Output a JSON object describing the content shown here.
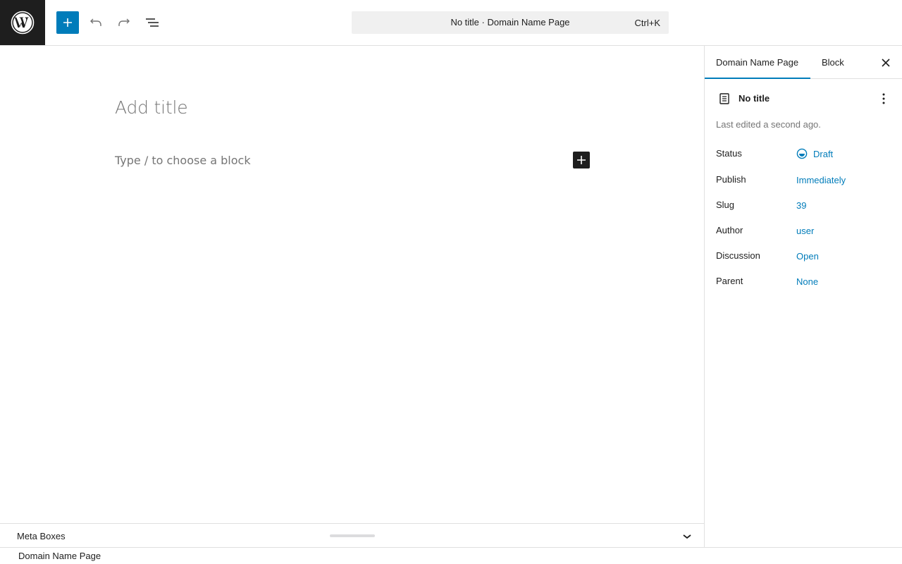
{
  "header": {
    "logo_icon": "wordpress-logo-icon",
    "inserter_icon": "plus-icon",
    "undo_icon": "undo-icon",
    "redo_icon": "redo-icon",
    "list_view_icon": "list-view-icon",
    "command_bar": {
      "title": "No title · Domain Name Page",
      "shortcut": "Ctrl+K"
    },
    "accent_color": "#007cba"
  },
  "editor": {
    "title_placeholder": "Add title",
    "block_placeholder": "Type / to choose a block"
  },
  "sidebar": {
    "tabs": [
      {
        "label": "Domain Name Page",
        "active": true
      },
      {
        "label": "Block",
        "active": false
      }
    ],
    "document": {
      "title": "No title",
      "last_edited": "Last edited a second ago."
    },
    "meta": [
      {
        "label": "Status",
        "value": "Draft"
      },
      {
        "label": "Publish",
        "value": "Immediately"
      },
      {
        "label": "Slug",
        "value": "39"
      },
      {
        "label": "Author",
        "value": "user"
      },
      {
        "label": "Discussion",
        "value": "Open"
      },
      {
        "label": "Parent",
        "value": "None"
      }
    ]
  },
  "meta_boxes": {
    "label": "Meta Boxes"
  },
  "footer": {
    "breadcrumb": "Domain Name Page"
  }
}
